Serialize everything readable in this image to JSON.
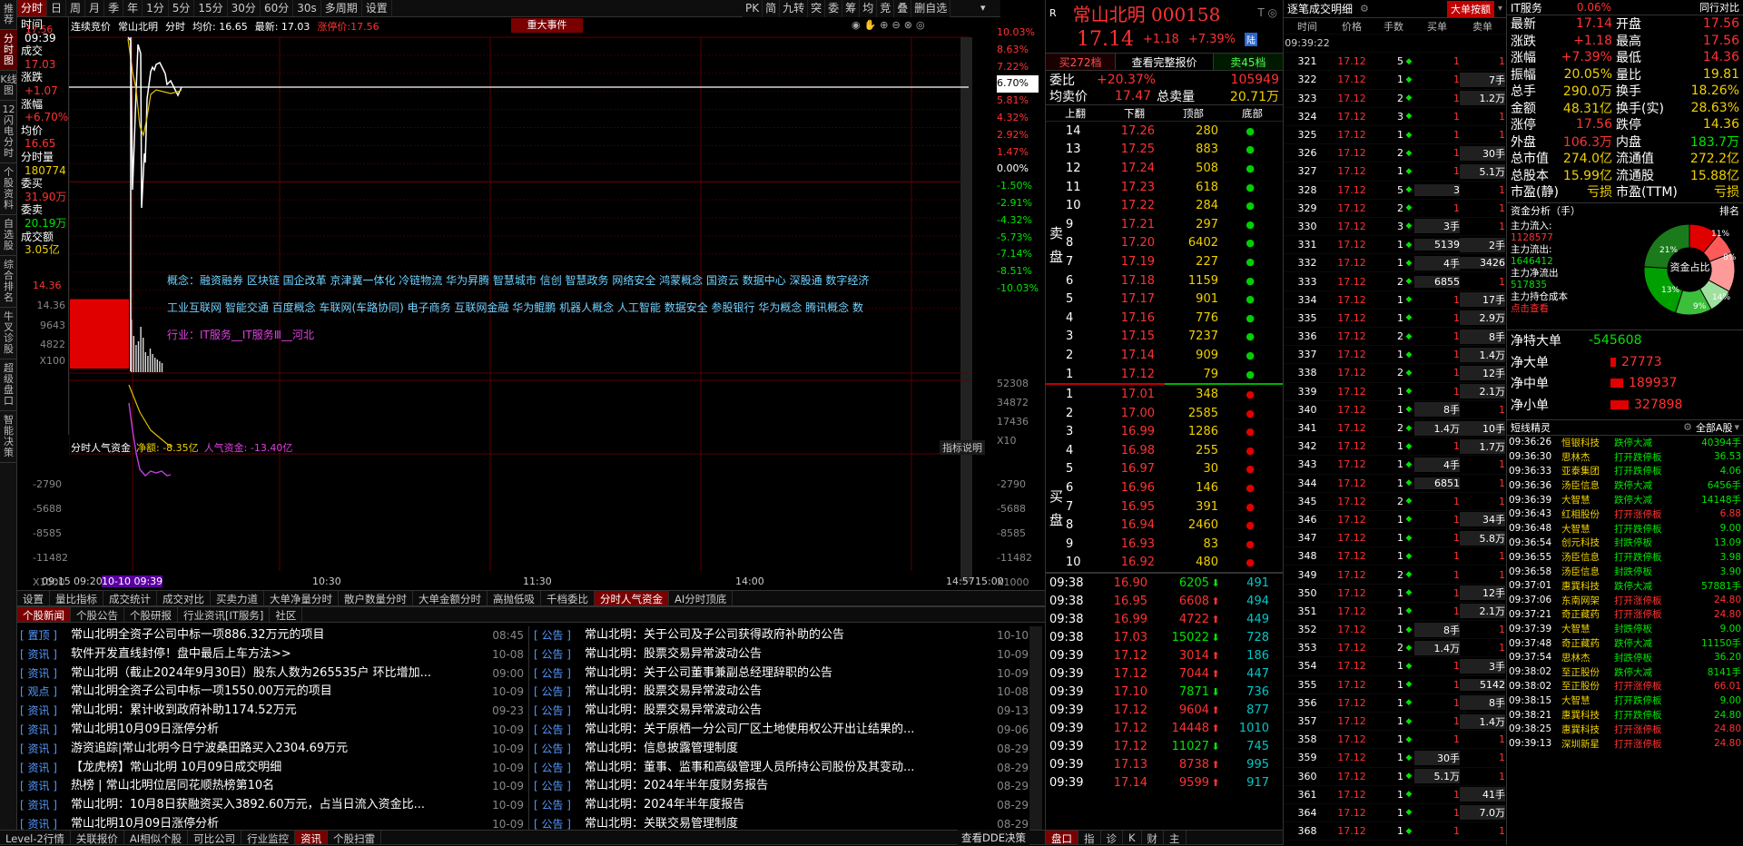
{
  "left_tabs": [
    "推荐",
    "分时图",
    "K线图",
    "12闪电分时",
    "个股资料",
    "自选股",
    "综合排名",
    "牛叉诊股",
    "超级盘口",
    "智能决策"
  ],
  "toolbar": [
    "分时",
    "日",
    "周",
    "月",
    "季",
    "年",
    "1分",
    "5分",
    "15分",
    "30分",
    "60分",
    "30s",
    "多周期",
    "设置"
  ],
  "toolbar_right": [
    "PK",
    "简",
    "九转",
    "突",
    "委",
    "筹",
    "均",
    "竞",
    "叠",
    "删自选"
  ],
  "info": {
    "time_label": "时间",
    "time": "09:39",
    "deal_label": "成交",
    "deal": "17.03",
    "chg_label": "涨跌",
    "chg": "+1.07",
    "pct_label": "涨幅",
    "pct": "+6.70%",
    "avg_label": "均价",
    "avg": "16.65",
    "vol_label": "分时量",
    "vol": "180774",
    "wb_label": "委买",
    "wb": "31.90万",
    "ws_label": "委卖",
    "ws": "20.19万",
    "amt_label": "成交额",
    "amt": "3.05亿"
  },
  "chart_header": {
    "mode": "连续竞价",
    "name": "常山北明",
    "kind": "分时",
    "avg_text": "均价: 16.65",
    "last_text": "最新: 17.03",
    "limit_text": "涨停价:17.56",
    "event_button": "重大事件"
  },
  "price_axis": {
    "left": [
      "17.56",
      "14.36"
    ],
    "right": [
      "10.03%",
      "8.63%",
      "7.22%",
      "6.70%",
      "5.81%",
      "4.32%",
      "2.92%",
      "1.47%",
      "0.00%",
      "-1.50%",
      "-2.91%",
      "-4.32%",
      "-5.73%",
      "-7.14%",
      "-8.51%",
      "-10.03%"
    ]
  },
  "vol_axis": {
    "left": [
      "14.36",
      "9643",
      "4822",
      "X100"
    ],
    "right": [
      "52308",
      "34872",
      "17436",
      "X10"
    ]
  },
  "concepts": [
    "概念：融资融券 区块链 国企改革 京津冀一体化 冷链物流 华为昇腾 智慧城市 信创 智慧政务 网络安全 鸿蒙概念 国资云 数据中心 深股通 数字经济",
    "工业互联网 智能交通 百度概念 车联网(车路协同) 电子商务 互联网金融 华为鲲鹏 机器人概念 人工智能 数据安全 参股银行 华为概念 腾讯概念 数",
    "行业：IT服务__IT服务Ⅲ__河北"
  ],
  "fund_chart": {
    "title": "分时人气资金",
    "net_label": "净额: -8.35亿",
    "pop_label": "人气资金: -13.40亿",
    "help": "指标说明",
    "left_axis": [
      "-2790",
      "-5688",
      "-8585",
      "-11482",
      "X1000"
    ],
    "right_axis": [
      "-2790",
      "-5688",
      "-8585",
      "-11482",
      "X1000"
    ]
  },
  "time_axis": [
    "09:15",
    "09:20",
    "10-10 09:39",
    "10:30",
    "11:30",
    "14:00",
    "14:57",
    "15:00"
  ],
  "indicator_tabs": [
    "设置",
    "量比指标",
    "成交统计",
    "成交对比",
    "买卖力道",
    "大单净量分时",
    "散户数量分时",
    "大单金额分时",
    "高抛低吸",
    "千档委比",
    "分时人气资金",
    "AI分时顶底"
  ],
  "news_tabs": [
    "个股新闻",
    "个股公告",
    "个股研报",
    "行业资讯[IT服务]",
    "社区"
  ],
  "news_left": [
    {
      "tag": "置顶",
      "title": "常山北明全资子公司中标一项886.32万元的项目",
      "date": "08:45"
    },
    {
      "tag": "资讯",
      "title": "软件开发直线封停！盘中最后上车方法>>",
      "date": "10-08"
    },
    {
      "tag": "资讯",
      "title": "常山北明（截止2024年9月30日）股东人数为265535户 环比增加...",
      "date": "09:00"
    },
    {
      "tag": "观点",
      "title": "常山北明全资子公司中标一项1550.00万元的项目",
      "date": "10-09"
    },
    {
      "tag": "资讯",
      "title": "常山北明：累计收到政府补助1174.52万元",
      "date": "09-23"
    },
    {
      "tag": "资讯",
      "title": "常山北明10月09日涨停分析",
      "date": "10-09"
    },
    {
      "tag": "资讯",
      "title": "游资追踪|常山北明今日宁波桑田路买入2304.69万元",
      "date": "10-09"
    },
    {
      "tag": "资讯",
      "title": "【龙虎榜】常山北明 10月09日成交明细",
      "date": "10-09"
    },
    {
      "tag": "资讯",
      "title": "热榜 | 常山北明位居同花顺热榜第10名",
      "date": "10-09"
    },
    {
      "tag": "资讯",
      "title": "常山北明：10月8日获融资买入3892.60万元，占当日流入资金比...",
      "date": "10-09"
    },
    {
      "tag": "资讯",
      "title": "常山北明10月09日涨停分析",
      "date": "10-09"
    }
  ],
  "news_right": [
    {
      "tag": "公告",
      "title": "常山北明：关于公司及子公司获得政府补助的公告",
      "date": "10-10"
    },
    {
      "tag": "公告",
      "title": "常山北明：股票交易异常波动公告",
      "date": "10-09"
    },
    {
      "tag": "公告",
      "title": "常山北明：关于公司董事兼副总经理辞职的公告",
      "date": "10-09"
    },
    {
      "tag": "公告",
      "title": "常山北明：股票交易异常波动公告",
      "date": "10-08"
    },
    {
      "tag": "公告",
      "title": "常山北明：股票交易异常波动公告",
      "date": "09-13"
    },
    {
      "tag": "公告",
      "title": "常山北明：关于原栖一分公司厂区土地使用权公开出让结果的...",
      "date": "09-06"
    },
    {
      "tag": "公告",
      "title": "常山北明：信息披露管理制度",
      "date": "08-29"
    },
    {
      "tag": "公告",
      "title": "常山北明：董事、监事和高级管理人员所持公司股份及其变动...",
      "date": "08-29"
    },
    {
      "tag": "公告",
      "title": "常山北明：2024年半年度财务报告",
      "date": "08-29"
    },
    {
      "tag": "公告",
      "title": "常山北明：2024年半年度报告",
      "date": "08-29"
    },
    {
      "tag": "公告",
      "title": "常山北明：关联交易管理制度",
      "date": "08-29"
    }
  ],
  "status_bar": [
    "Level-2行情",
    "关联报价",
    "AI相似个股",
    "可比公司",
    "行业监控",
    "资讯",
    "个股扫雷"
  ],
  "status_bar_right": "查看DDE决策",
  "orderbook": {
    "title": "常山北明 000158",
    "price": "17.14",
    "chg": "+1.18",
    "pct": "+7.39%",
    "tag": "陆",
    "tabs": [
      "买272档",
      "查看完整报价",
      "卖45档"
    ],
    "weibi_label": "委比",
    "weibi": "+20.37%",
    "weicha": "105949",
    "avg_label": "均卖价",
    "avg": "17.47",
    "total_label": "总卖量",
    "total": "20.71万",
    "cols": [
      "上翻",
      "下翻",
      "顶部",
      "底部"
    ],
    "sell_label": "卖盘",
    "buy_label": "买盘",
    "asks": [
      [
        "14",
        "17.26",
        "280"
      ],
      [
        "13",
        "17.25",
        "883"
      ],
      [
        "12",
        "17.24",
        "508"
      ],
      [
        "11",
        "17.23",
        "618"
      ],
      [
        "10",
        "17.22",
        "284"
      ],
      [
        "9",
        "17.21",
        "297"
      ],
      [
        "8",
        "17.20",
        "6402"
      ],
      [
        "7",
        "17.19",
        "227"
      ],
      [
        "6",
        "17.18",
        "1159"
      ],
      [
        "5",
        "17.17",
        "901"
      ],
      [
        "4",
        "17.16",
        "776"
      ],
      [
        "3",
        "17.15",
        "7237"
      ],
      [
        "2",
        "17.14",
        "909"
      ],
      [
        "1",
        "17.12",
        "79"
      ]
    ],
    "bids": [
      [
        "1",
        "17.01",
        "348"
      ],
      [
        "2",
        "17.00",
        "2585"
      ],
      [
        "3",
        "16.99",
        "1286"
      ],
      [
        "4",
        "16.98",
        "255"
      ],
      [
        "5",
        "16.97",
        "30"
      ],
      [
        "6",
        "16.96",
        "146"
      ],
      [
        "7",
        "16.95",
        "391"
      ],
      [
        "8",
        "16.94",
        "2460"
      ],
      [
        "9",
        "16.93",
        "83"
      ],
      [
        "10",
        "16.92",
        "480"
      ]
    ],
    "ticks": [
      [
        "09:38",
        "16.90",
        "6205",
        "491"
      ],
      [
        "09:38",
        "16.95",
        "6608",
        "494"
      ],
      [
        "09:38",
        "16.99",
        "4722",
        "449"
      ],
      [
        "09:38",
        "17.03",
        "15022",
        "728"
      ],
      [
        "09:39",
        "17.12",
        "3014",
        "186"
      ],
      [
        "09:39",
        "17.12",
        "7044",
        "447"
      ],
      [
        "09:39",
        "17.10",
        "7871",
        "736"
      ],
      [
        "09:39",
        "17.12",
        "9604",
        "877"
      ],
      [
        "09:39",
        "17.12",
        "14448",
        "1010"
      ],
      [
        "09:39",
        "17.12",
        "11027",
        "745"
      ],
      [
        "09:39",
        "17.13",
        "8738",
        "995"
      ],
      [
        "09:39",
        "17.14",
        "9599",
        "917"
      ]
    ],
    "bottom_tabs": [
      "盘口",
      "指",
      "诊",
      "K",
      "财",
      "主"
    ]
  },
  "trade_detail": {
    "title": "逐笔成交明细",
    "btn": "大单按额",
    "cols": [
      "时间",
      "价格",
      "手数",
      "买单",
      "卖单"
    ],
    "first_time": "09:39:22",
    "rows": [
      [
        "321",
        "17.12",
        "5",
        "1",
        "1"
      ],
      [
        "322",
        "17.12",
        "1",
        "1",
        "7手"
      ],
      [
        "323",
        "17.12",
        "2",
        "1",
        "1.2万"
      ],
      [
        "324",
        "17.12",
        "3",
        "1",
        "1"
      ],
      [
        "325",
        "17.12",
        "1",
        "1",
        "1"
      ],
      [
        "326",
        "17.12",
        "2",
        "1",
        "30手"
      ],
      [
        "327",
        "17.12",
        "1",
        "1",
        "5.1万"
      ],
      [
        "328",
        "17.12",
        "5",
        "3",
        "1"
      ],
      [
        "329",
        "17.12",
        "2",
        "1",
        "1"
      ],
      [
        "330",
        "17.12",
        "3",
        "3手",
        "1"
      ],
      [
        "331",
        "17.12",
        "1",
        "5139",
        "2手"
      ],
      [
        "332",
        "17.12",
        "1",
        "4手",
        "3426"
      ],
      [
        "333",
        "17.12",
        "2",
        "6855",
        "1"
      ],
      [
        "334",
        "17.12",
        "1",
        "1",
        "17手"
      ],
      [
        "335",
        "17.12",
        "1",
        "1",
        "2.9万"
      ],
      [
        "336",
        "17.12",
        "2",
        "1",
        "8手"
      ],
      [
        "337",
        "17.12",
        "1",
        "1",
        "1.4万"
      ],
      [
        "338",
        "17.12",
        "2",
        "1",
        "12手"
      ],
      [
        "339",
        "17.12",
        "1",
        "1",
        "2.1万"
      ],
      [
        "340",
        "17.12",
        "1",
        "8手",
        "1"
      ],
      [
        "341",
        "17.12",
        "2",
        "1.4万",
        "10手"
      ],
      [
        "342",
        "17.12",
        "1",
        "1",
        "1.7万"
      ],
      [
        "343",
        "17.12",
        "1",
        "4手",
        "1"
      ],
      [
        "344",
        "17.12",
        "1",
        "6851",
        "1"
      ],
      [
        "345",
        "17.12",
        "2",
        "1",
        "1"
      ],
      [
        "346",
        "17.12",
        "1",
        "1",
        "34手"
      ],
      [
        "347",
        "17.12",
        "1",
        "1",
        "5.8万"
      ],
      [
        "348",
        "17.12",
        "1",
        "1",
        "1"
      ],
      [
        "349",
        "17.12",
        "2",
        "1",
        "1"
      ],
      [
        "350",
        "17.12",
        "1",
        "1",
        "12手"
      ],
      [
        "351",
        "17.12",
        "1",
        "1",
        "2.1万"
      ],
      [
        "352",
        "17.12",
        "1",
        "8手",
        "1"
      ],
      [
        "353",
        "17.12",
        "2",
        "1.4万",
        "1"
      ],
      [
        "354",
        "17.12",
        "1",
        "1",
        "3手"
      ],
      [
        "355",
        "17.12",
        "1",
        "1",
        "5142"
      ],
      [
        "356",
        "17.12",
        "1",
        "1",
        "8手"
      ],
      [
        "357",
        "17.12",
        "1",
        "1",
        "1.4万"
      ],
      [
        "358",
        "17.12",
        "1",
        "1",
        "1"
      ],
      [
        "359",
        "17.12",
        "1",
        "30手",
        "1"
      ],
      [
        "360",
        "17.12",
        "1",
        "5.1万",
        "1"
      ],
      [
        "361",
        "17.12",
        "1",
        "1",
        "41手"
      ],
      [
        "364",
        "17.12",
        "1",
        "1",
        "7.0万"
      ],
      [
        "368",
        "17.12",
        "1",
        "1",
        "1"
      ]
    ]
  },
  "quote": {
    "name": "IT服务",
    "pct": "0.06%",
    "right_tag": "同行对比",
    "rows": [
      [
        "最新",
        "17.14",
        "开盘",
        "17.56"
      ],
      [
        "涨跌",
        "+1.18",
        "最高",
        "17.56"
      ],
      [
        "涨幅",
        "+7.39%",
        "最低",
        "14.36"
      ],
      [
        "振幅",
        "20.05%",
        "量比",
        "19.81"
      ],
      [
        "总手",
        "290.0万",
        "换手",
        "18.26%"
      ],
      [
        "金额",
        "48.31亿",
        "换手(实)",
        "28.63%"
      ],
      [
        "涨停",
        "17.56",
        "跌停",
        "14.36"
      ],
      [
        "外盘",
        "106.3万",
        "内盘",
        "183.7万"
      ],
      [
        "总市值",
        "274.0亿",
        "流通值",
        "272.2亿"
      ],
      [
        "总股本",
        "15.99亿",
        "流通股",
        "15.88亿"
      ],
      [
        "市盈(静)",
        "亏损",
        "市盈(TTM)",
        "亏损"
      ]
    ]
  },
  "capital": {
    "title": "资金分析（手）",
    "rank": "排名",
    "in_label": "主力流入:",
    "in": "1128577",
    "out_label": "主力流出:",
    "out": "1646412",
    "net_label": "主力净流出",
    "net": "517835",
    "cost_label": "主力持仓成本",
    "cost_link": "点击查看",
    "pie_center": "资金占比",
    "pie": [
      {
        "v": 11,
        "c": "#e00000"
      },
      {
        "v": 8,
        "c": "#ff5a5a"
      },
      {
        "v": 14,
        "c": "#ff9a9a"
      },
      {
        "v": 9,
        "c": "#9fe09f"
      },
      {
        "v": 13,
        "c": "#3cc03c"
      },
      {
        "v": 21,
        "c": "#00a000"
      },
      {
        "v": 24,
        "c": "#1b7a1b"
      }
    ],
    "pie_labels": [
      "11%",
      "8%",
      "14%",
      "9%",
      "13%",
      "21%"
    ]
  },
  "big_orders": [
    [
      "净特大单",
      "-545608"
    ],
    [
      "净大单",
      "27773"
    ],
    [
      "净中单",
      "189937"
    ],
    [
      "净小单",
      "327898"
    ]
  ],
  "short_wizard": {
    "title": "短线精灵",
    "filter": "全部A股",
    "rows": [
      [
        "09:36:26",
        "恒银科技",
        "跌停大减",
        "40394手"
      ],
      [
        "09:36:30",
        "思林杰",
        "打开跌停板",
        "36.53"
      ],
      [
        "09:36:33",
        "亚泰集团",
        "打开跌停板",
        "4.06"
      ],
      [
        "09:36:36",
        "汤臣信息",
        "跌停大减",
        "6456手"
      ],
      [
        "09:36:39",
        "大智慧",
        "跌停大减",
        "14148手"
      ],
      [
        "09:36:43",
        "红相股份",
        "打开涨停板",
        "6.88"
      ],
      [
        "09:36:48",
        "大智慧",
        "打开跌停板",
        "9.00"
      ],
      [
        "09:36:54",
        "创元科技",
        "封跌停板",
        "13.09"
      ],
      [
        "09:36:55",
        "汤臣信息",
        "打开跌停板",
        "3.98"
      ],
      [
        "09:36:58",
        "汤臣信息",
        "封跌停板",
        "3.90"
      ],
      [
        "09:37:01",
        "惠巽科技",
        "跌停大减",
        "57881手"
      ],
      [
        "09:37:06",
        "东南网架",
        "打开涨停板",
        "24.80"
      ],
      [
        "09:37:21",
        "奇正藏药",
        "打开涨停板",
        "24.80"
      ],
      [
        "09:37:39",
        "大智慧",
        "封跌停板",
        "9.00"
      ],
      [
        "09:37:48",
        "奇正藏药",
        "跌停大减",
        "11150手"
      ],
      [
        "09:37:54",
        "思林杰",
        "封跌停板",
        "36.20"
      ],
      [
        "09:38:02",
        "至正股份",
        "跌停大减",
        "8141手"
      ],
      [
        "09:38:02",
        "至正股份",
        "打开涨停板",
        "66.01"
      ],
      [
        "09:38:15",
        "大智慧",
        "打开跌停板",
        "9.00"
      ],
      [
        "09:38:21",
        "惠巽科技",
        "打开跌停板",
        "24.80"
      ],
      [
        "09:38:25",
        "惠巽科技",
        "打开涨停板",
        "24.80"
      ],
      [
        "09:39:13",
        "深圳新星",
        "打开涨停板",
        "24.80"
      ]
    ]
  }
}
